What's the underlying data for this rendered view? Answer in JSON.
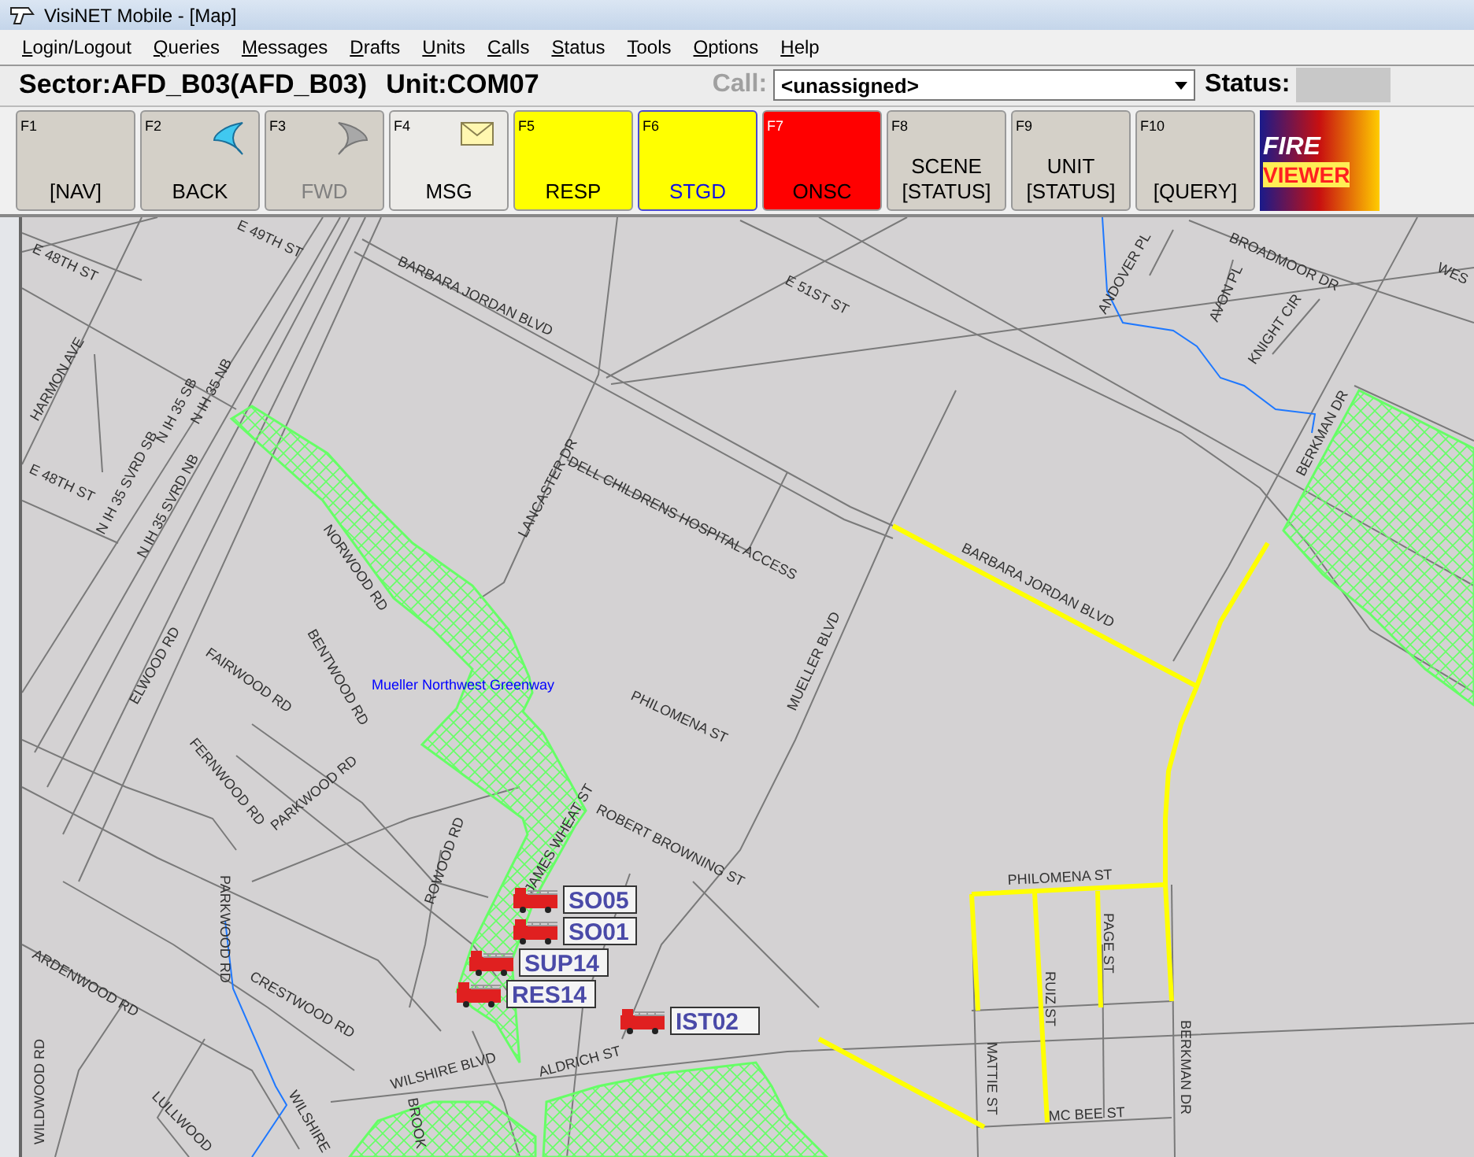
{
  "window": {
    "title": "VisiNET Mobile - [Map]"
  },
  "menu": [
    "Login/Logout",
    "Queries",
    "Messages",
    "Drafts",
    "Units",
    "Calls",
    "Status",
    "Tools",
    "Options",
    "Help"
  ],
  "info_bar": {
    "sector": "Sector:AFD_B03(AFD_B03)",
    "unit": "Unit:COM07",
    "call_label": "Call:",
    "call_value": "<unassigned>",
    "status_label": "Status:"
  },
  "function_keys": [
    {
      "key": "F1",
      "label": "[NAV]",
      "kind": "text",
      "color": "#d4d0c8",
      "disabled": false,
      "selected": false
    },
    {
      "key": "F2",
      "label": "BACK",
      "kind": "back",
      "color": "#d4d0c8",
      "disabled": false,
      "selected": false
    },
    {
      "key": "F3",
      "label": "FWD",
      "kind": "forward",
      "color": "#d4d0c8",
      "disabled": true,
      "selected": false
    },
    {
      "key": "F4",
      "label": "MSG",
      "kind": "mail",
      "color": "#ecebe8",
      "disabled": false,
      "selected": false
    },
    {
      "key": "F5",
      "label": "RESP",
      "kind": "text",
      "color": "#ffff00",
      "disabled": false,
      "selected": false
    },
    {
      "key": "F6",
      "label": "STGD",
      "kind": "text",
      "color": "#ffff00",
      "disabled": false,
      "selected": true
    },
    {
      "key": "F7",
      "label": "ONSC",
      "kind": "text",
      "color": "#ff0000",
      "disabled": false,
      "selected": false
    },
    {
      "key": "F8",
      "label": "SCENE [STATUS]",
      "kind": "text",
      "color": "#d4d0c8",
      "disabled": false,
      "selected": false
    },
    {
      "key": "F9",
      "label": "UNIT [STATUS]",
      "kind": "text",
      "color": "#d4d0c8",
      "disabled": false,
      "selected": false
    },
    {
      "key": "F10",
      "label": "[QUERY]",
      "kind": "text",
      "color": "#d4d0c8",
      "disabled": false,
      "selected": false
    }
  ],
  "logo": {
    "line1": "FIRE",
    "line2": "VIEWER"
  },
  "map": {
    "streets": [
      "E 49TH ST",
      "E 48TH ST",
      "HARMON AVE",
      "E 48TH ST",
      "N IH 35 SVRD SB",
      "N IH 35 SB",
      "N IH 35 NB",
      "N IH 35 SVRD NB",
      "BARBARA JORDAN BLVD",
      "E 51ST ST",
      "ANDOVER PL",
      "AVON PL",
      "BROADMOOR DR",
      "KNIGHT CIR",
      "WES",
      "BERKMAN DR",
      "LANCASTER DR",
      "DELL CHILDRENS HOSPITAL ACCESS",
      "MUELLER BLVD",
      "BARBARA JORDAN BLVD",
      "NORWOOD RD",
      "BENTWOOD RD",
      "ELWOOD RD",
      "FAIRWOOD RD",
      "FERNWOOD RD",
      "PARKWOOD RD",
      "PHILOMENA ST",
      "JAMES WHEAT ST",
      "ROBERT BROWNING ST",
      "ROWOOD RD",
      "PARKWOOD RD",
      "ARDENWOOD RD",
      "CRESTWOOD RD",
      "WILDWOOD RD",
      "LULLWOOD",
      "WILSHIRE",
      "WILSHIRE BLVD",
      "BROOK",
      "ALDRICH ST",
      "PHILOMENA ST",
      "PAGE ST",
      "RUIZ ST",
      "MATTIE ST",
      "BERKMAN DR",
      "MC BEE ST"
    ],
    "park_label": "Mueller Northwest Greenway",
    "units": [
      "SO05",
      "SO01",
      "SUP14",
      "RES14",
      "IST02"
    ]
  }
}
